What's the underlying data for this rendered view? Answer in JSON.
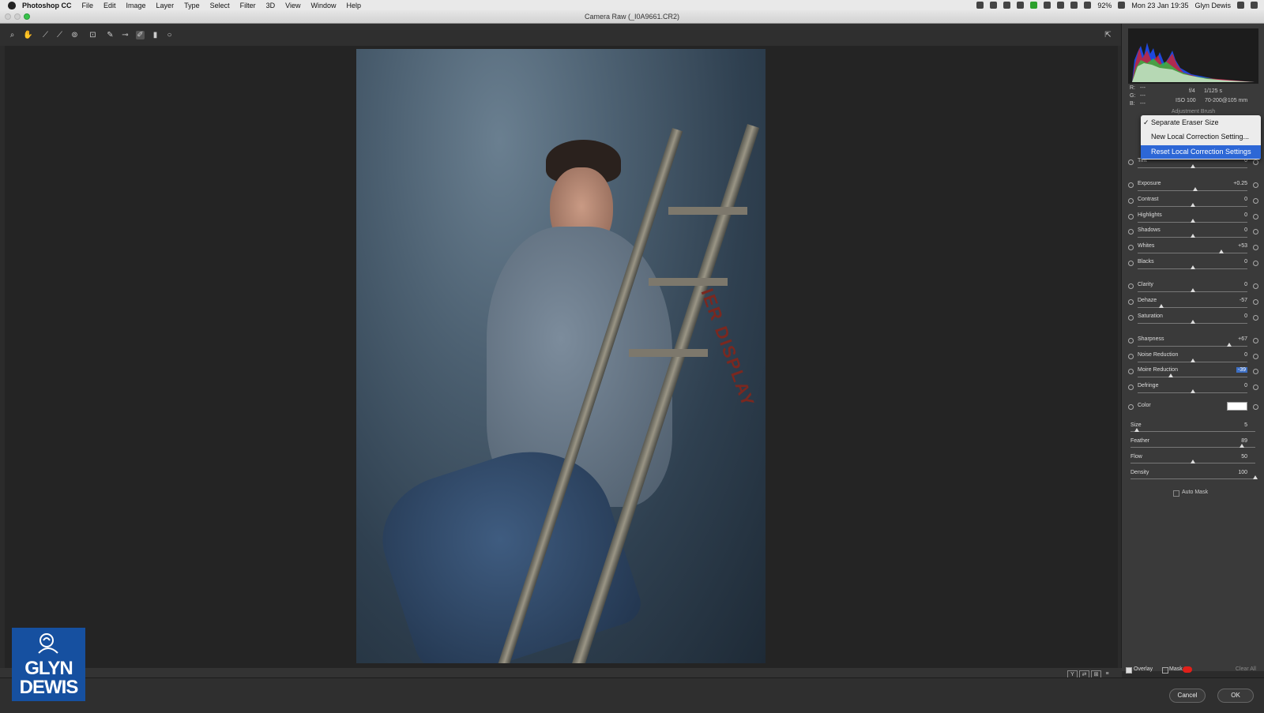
{
  "menubar": {
    "app_name": "Photoshop CC",
    "items": [
      "File",
      "Edit",
      "Image",
      "Layer",
      "Type",
      "Select",
      "Filter",
      "3D",
      "View",
      "Window",
      "Help"
    ],
    "battery": "92%",
    "datetime": "Mon 23 Jan 19:35",
    "user": "Glyn Dewis"
  },
  "window": {
    "title": "Camera Raw (_I0A9661.CR2)"
  },
  "toolbar": {
    "tools": [
      "zoom-tool-icon",
      "hand-tool-icon",
      "white-balance-tool-icon",
      "color-sampler-icon",
      "targeted-adjustment-icon",
      "crop-tool-icon",
      "straighten-tool-icon",
      "spot-removal-icon",
      "adjustment-brush-icon",
      "graduated-filter-icon",
      "radial-filter-icon"
    ]
  },
  "info": {
    "r_label": "R:",
    "r_value": "---",
    "g_label": "G:",
    "g_value": "---",
    "b_label": "B:",
    "b_value": "---",
    "aperture": "f/4",
    "shutter": "1/125 s",
    "iso": "ISO 100",
    "lens": "70-200@105 mm"
  },
  "panel": {
    "title": "Adjustment Brush"
  },
  "dropdown": {
    "items": [
      {
        "label": "Separate Eraser Size",
        "checked": true
      },
      {
        "label": "New Local Correction Setting..."
      },
      {
        "label": "Reset Local Correction Settings",
        "selected": true
      }
    ]
  },
  "adjustments": [
    {
      "label": "Tint",
      "value": "0",
      "level": 0.5
    },
    {
      "label": "Exposure",
      "value": "+0.25",
      "level": 0.525
    },
    {
      "label": "Contrast",
      "value": "0",
      "level": 0.5
    },
    {
      "label": "Highlights",
      "value": "0",
      "level": 0.5
    },
    {
      "label": "Shadows",
      "value": "0",
      "level": 0.5
    },
    {
      "label": "Whites",
      "value": "+53",
      "level": 0.765
    },
    {
      "label": "Blacks",
      "value": "0",
      "level": 0.5
    },
    {
      "label": "Clarity",
      "value": "0",
      "level": 0.5
    },
    {
      "label": "Dehaze",
      "value": "-57",
      "level": 0.215
    },
    {
      "label": "Saturation",
      "value": "0",
      "level": 0.5
    },
    {
      "label": "Sharpness",
      "value": "+67",
      "level": 0.835
    },
    {
      "label": "Noise Reduction",
      "value": "0",
      "level": 0.5
    },
    {
      "label": "Moire Reduction",
      "value": "-39",
      "level": 0.305,
      "selected": true
    },
    {
      "label": "Defringe",
      "value": "0",
      "level": 0.5
    }
  ],
  "color": {
    "label": "Color",
    "swatch": "#ffffff"
  },
  "brush": [
    {
      "label": "Size",
      "value": "5",
      "level": 0.05
    },
    {
      "label": "Feather",
      "value": "89",
      "level": 0.89
    },
    {
      "label": "Flow",
      "value": "50",
      "level": 0.5
    },
    {
      "label": "Density",
      "value": "100",
      "level": 1.0
    }
  ],
  "auto_mask": {
    "label": "Auto Mask"
  },
  "overlay": {
    "overlay_label": "Overlay",
    "mask_label": "Mask",
    "mask_color": "#e0201a",
    "clear_all": "Clear All"
  },
  "buttons": {
    "cancel": "Cancel",
    "ok": "OK"
  },
  "logo": {
    "line1": "GLYN",
    "line2": "DEWIS"
  },
  "photo": {
    "ladder_text": "IER DISPLAY"
  },
  "colors": {
    "accent": "#2d67d6",
    "logo_bg": "#1650a0"
  }
}
